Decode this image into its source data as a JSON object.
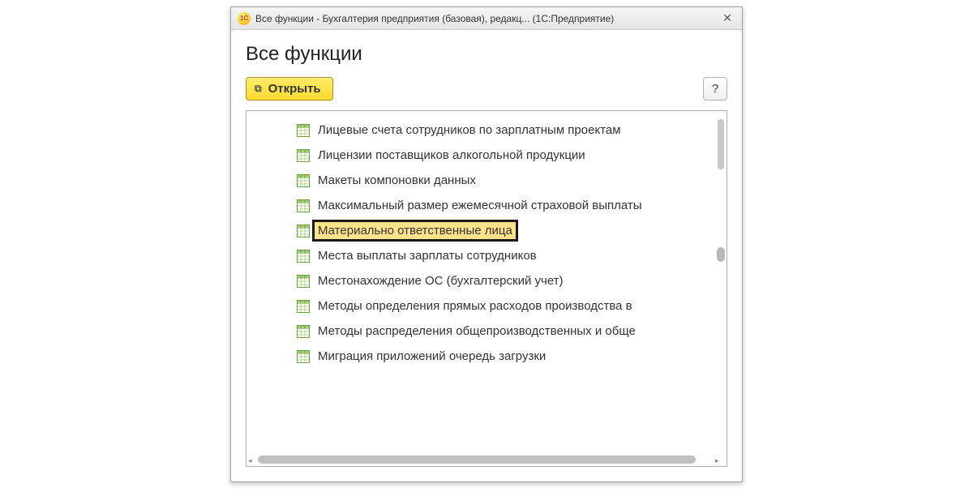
{
  "window": {
    "title": "Все функции - Бухгалтерия предприятия (базовая), редакц... (1С:Предприятие)"
  },
  "page": {
    "title": "Все функции"
  },
  "toolbar": {
    "open_label": "Открыть",
    "help_label": "?"
  },
  "tree": {
    "items": [
      {
        "label": "Лицевые счета сотрудников по зарплатным проектам",
        "highlighted": false
      },
      {
        "label": "Лицензии поставщиков алкогольной продукции",
        "highlighted": false
      },
      {
        "label": "Макеты компоновки данных",
        "highlighted": false
      },
      {
        "label": "Максимальный размер ежемесячной страховой выплаты",
        "highlighted": false
      },
      {
        "label": "Материально ответственные лица",
        "highlighted": true
      },
      {
        "label": "Места выплаты зарплаты сотрудников",
        "highlighted": false
      },
      {
        "label": "Местонахождение ОС (бухгалтерский учет)",
        "highlighted": false
      },
      {
        "label": "Методы определения прямых расходов производства в",
        "highlighted": false
      },
      {
        "label": "Методы распределения общепроизводственных и обще",
        "highlighted": false
      },
      {
        "label": "Миграция приложений очередь загрузки",
        "highlighted": false
      }
    ]
  }
}
